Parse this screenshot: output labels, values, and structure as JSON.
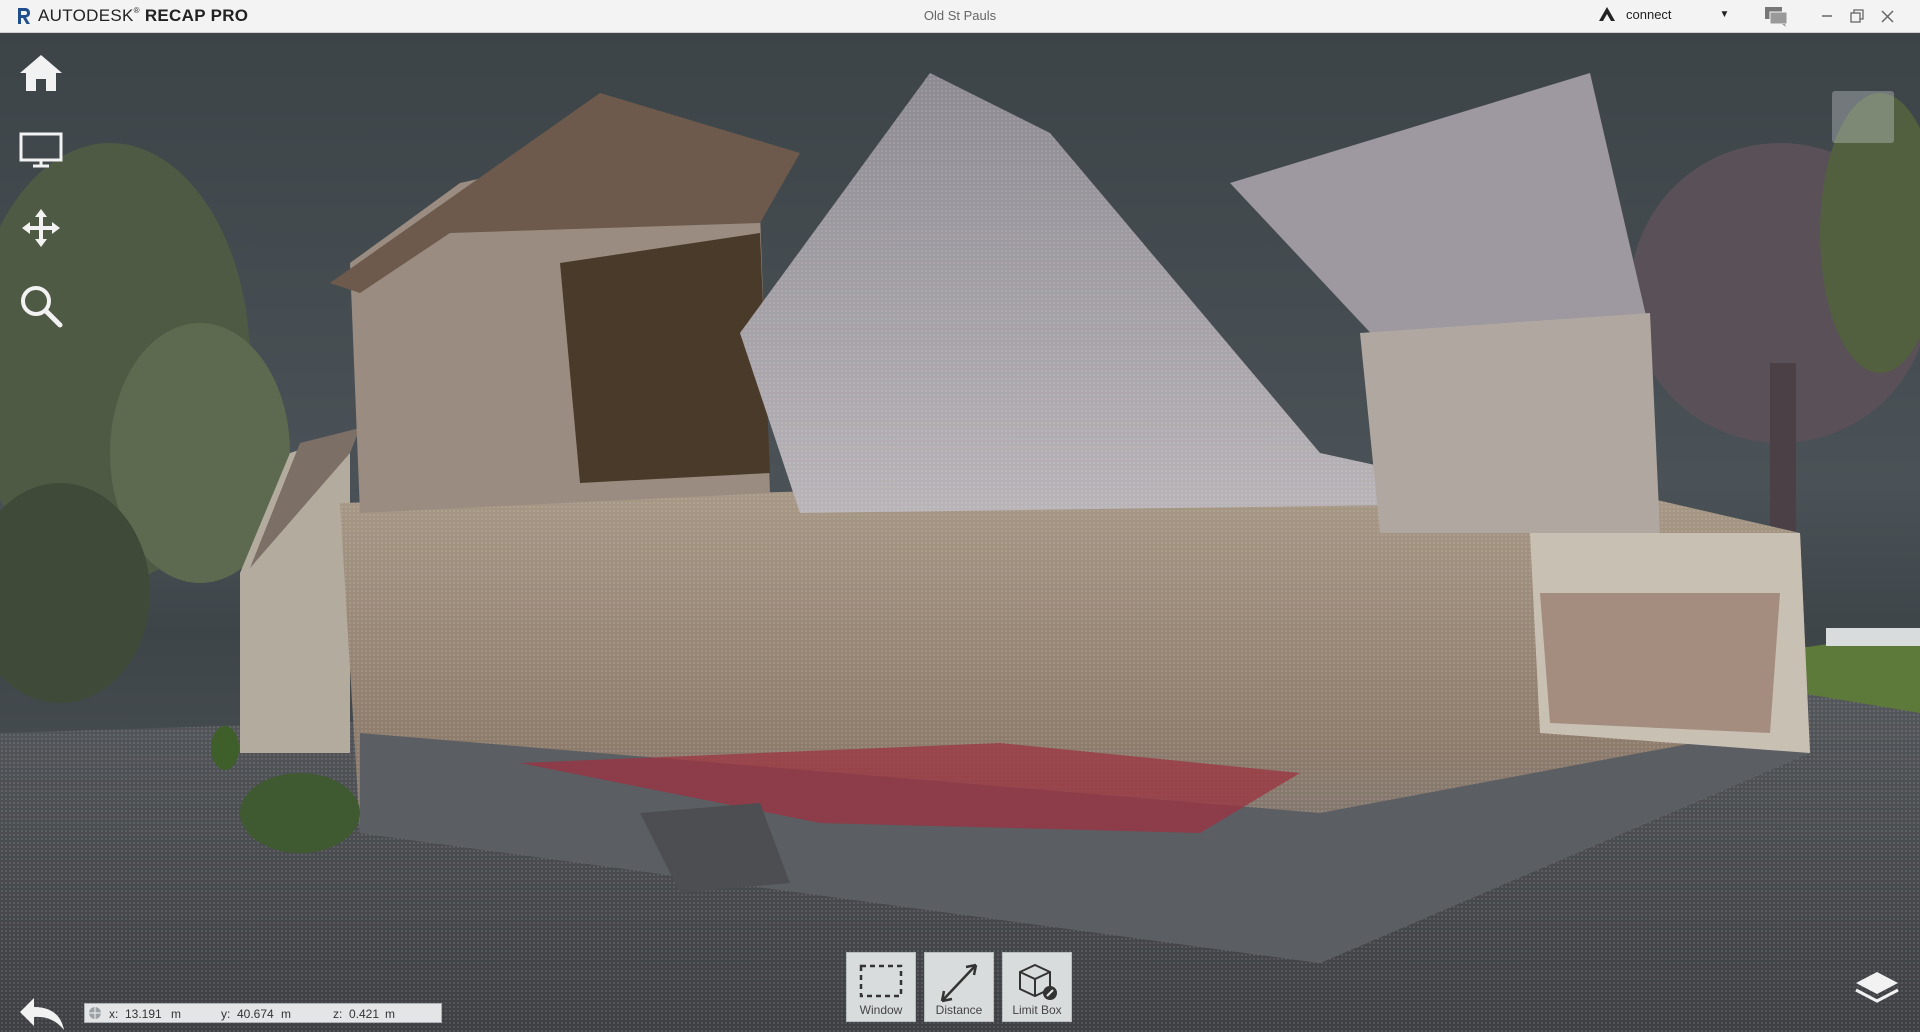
{
  "app": {
    "brand_prefix": "AUTODESK",
    "brand_suffix": "RECAP PRO",
    "document_title": "Old St Pauls",
    "account_label": "connect"
  },
  "left_toolbar": {
    "items": [
      "home-icon",
      "display-settings-icon",
      "navigation-pan-icon",
      "search-icon"
    ]
  },
  "bottom_toolbar": {
    "tools": [
      {
        "label": "Window",
        "icon": "window-select-icon"
      },
      {
        "label": "Distance",
        "icon": "distance-measure-icon"
      },
      {
        "label": "Limit Box",
        "icon": "limit-box-icon"
      }
    ]
  },
  "coordinates": {
    "x_label": "x:",
    "x_value": "13.191",
    "x_unit": "m",
    "y_label": "y:",
    "y_value": "40.674",
    "y_unit": "m",
    "z_label": "z:",
    "z_value": "0.421",
    "z_unit": "m"
  },
  "colors": {
    "titlebar": "#f3f3f3",
    "viewport_background": "#4a5257",
    "toolbar_button": "#d9dcdd",
    "brand_blue": "#1f4e8c"
  }
}
